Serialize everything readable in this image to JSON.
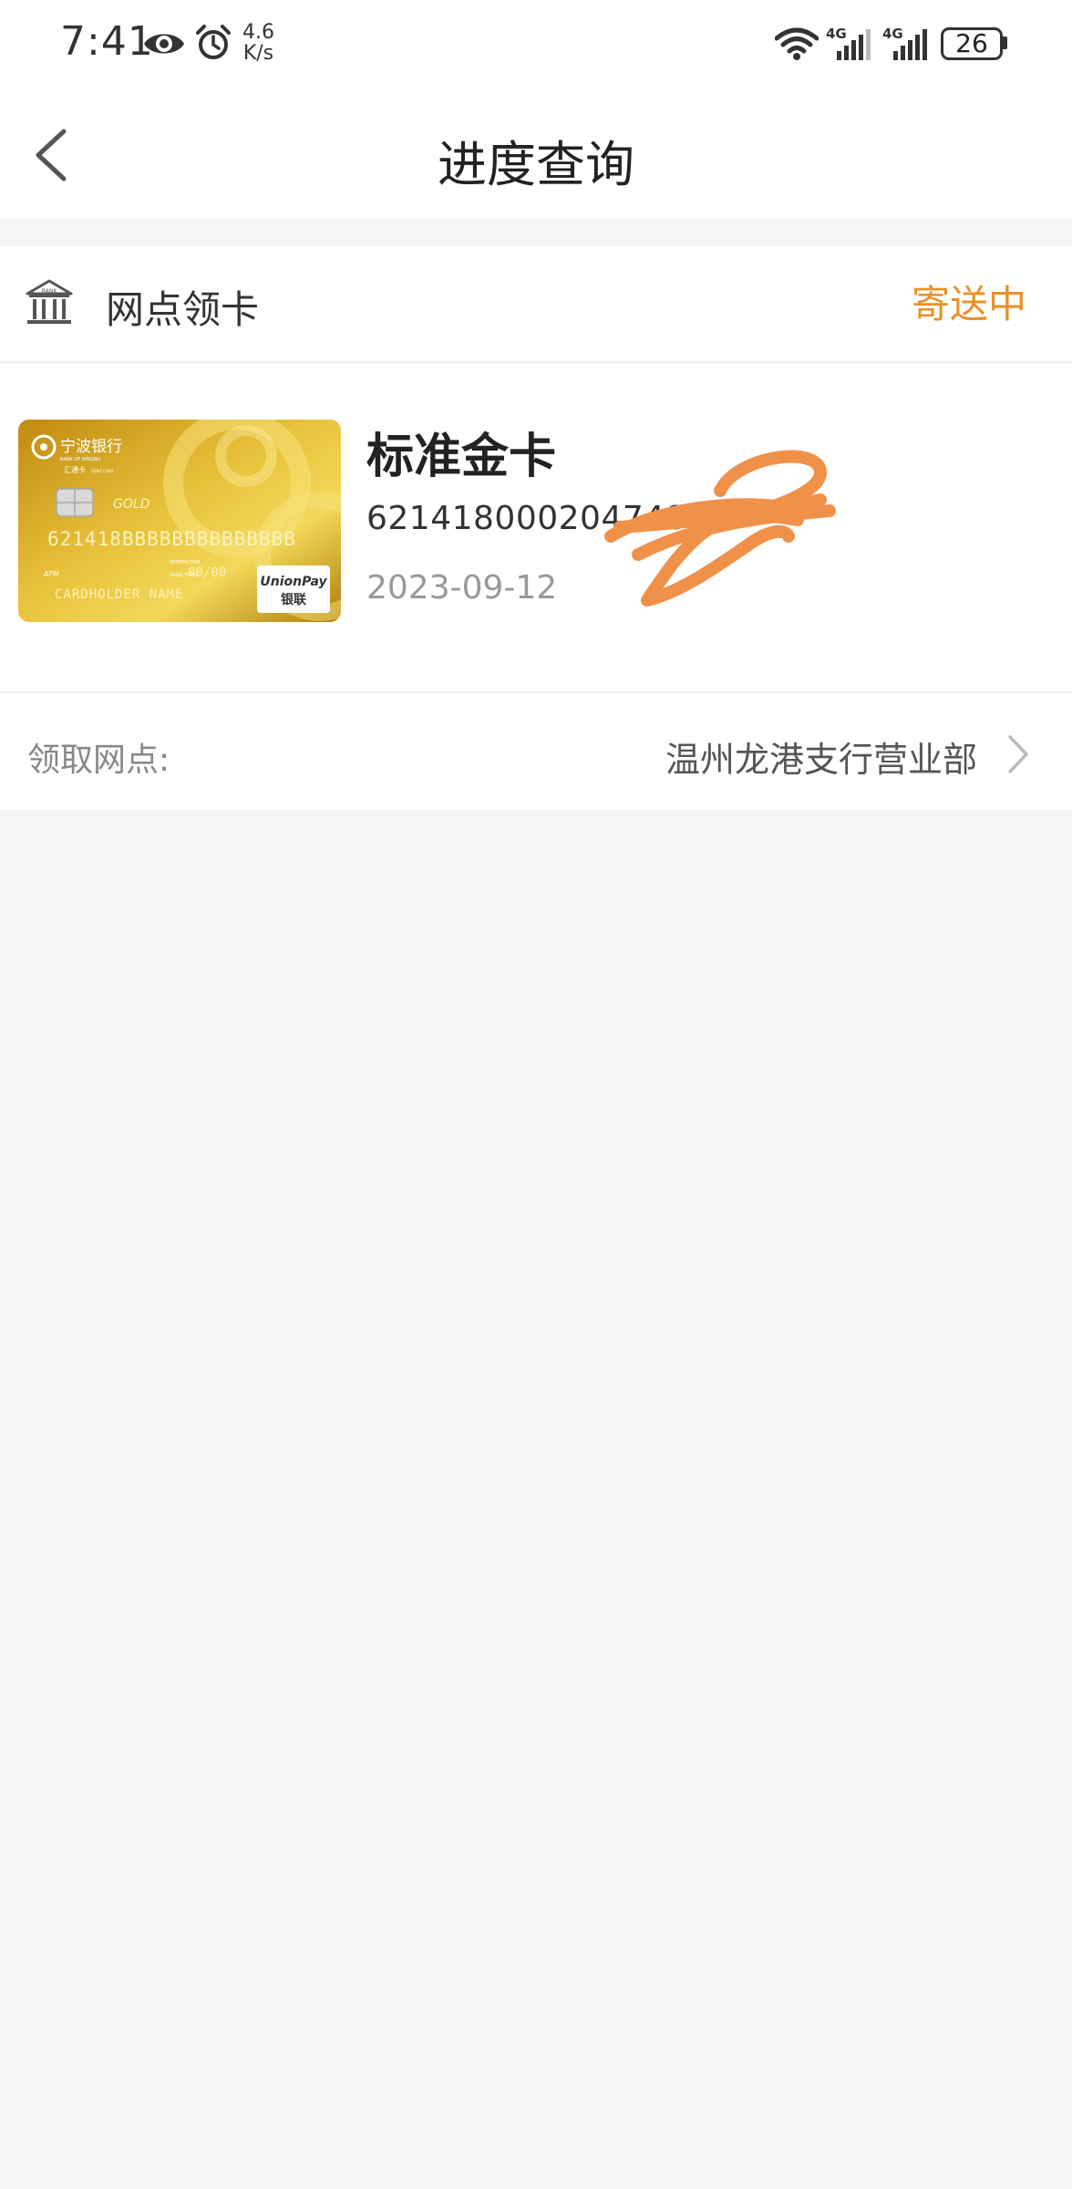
{
  "status_bar": {
    "time": "7:41",
    "net_speed_value": "4.6",
    "net_speed_unit": "K/s",
    "signal_label_1": "4G",
    "signal_label_2": "4G",
    "battery": "26"
  },
  "nav": {
    "title": "进度查询",
    "icons": {
      "back": "chevron-left-icon"
    }
  },
  "card_section": {
    "pickup_mode": "网点领卡",
    "status": "寄送中",
    "card_name": "标准金卡",
    "card_number": "621418000204748",
    "date": "2023-09-12",
    "card_image": {
      "bank_name": "宁波银行",
      "bank_name_en": "BANK OF NINGBO",
      "card_type": "汇通卡",
      "card_type_en": "DEBIT CARD",
      "tier": "GOLD",
      "number_placeholder": "621418BBBBBBBBBBBBBB",
      "expiry_caption": "MONTH/YEAR",
      "valid_caption": "VALID THRU",
      "expiry_value": "00/00",
      "holder": "CARDHOLDER NAME",
      "atm": "ATM",
      "network": "UnionPay",
      "network_cn": "银联"
    }
  },
  "branch_row": {
    "label": "领取网点:",
    "value": "温州龙港支行营业部",
    "icons": {
      "arrow": "chevron-right-icon"
    }
  },
  "colors": {
    "status_orange": "#e8912a",
    "scribble_orange": "#f0914a",
    "background": "#f5f5f5",
    "card_gold": "#d4a017"
  }
}
